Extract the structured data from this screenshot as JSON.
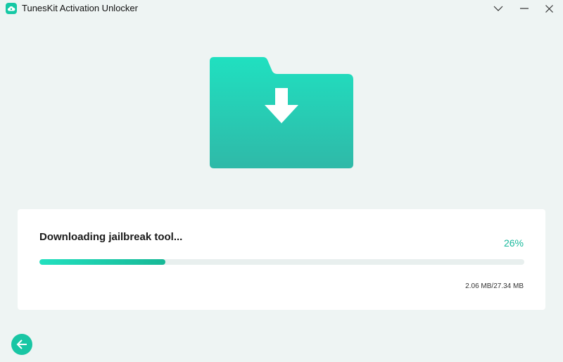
{
  "window": {
    "title": "TunesKit Activation Unlocker",
    "logo_icon": "cloud-lock-icon",
    "controls": [
      "chevron-down-icon",
      "minimize-icon",
      "close-icon"
    ]
  },
  "hero": {
    "icon": "folder-download-icon",
    "colors": {
      "folder_top": "#20e0c0",
      "folder_bottom": "#2fb9a8"
    }
  },
  "download": {
    "status_text": "Downloading jailbreak tool...",
    "percent_text": "26%",
    "progress": 0.26,
    "size_text": "2.06 MB/27.34 MB"
  },
  "footer": {
    "back_icon": "arrow-left-icon"
  },
  "colors": {
    "accent": "#19c6a4",
    "background": "#eef4f3",
    "card": "#ffffff"
  }
}
